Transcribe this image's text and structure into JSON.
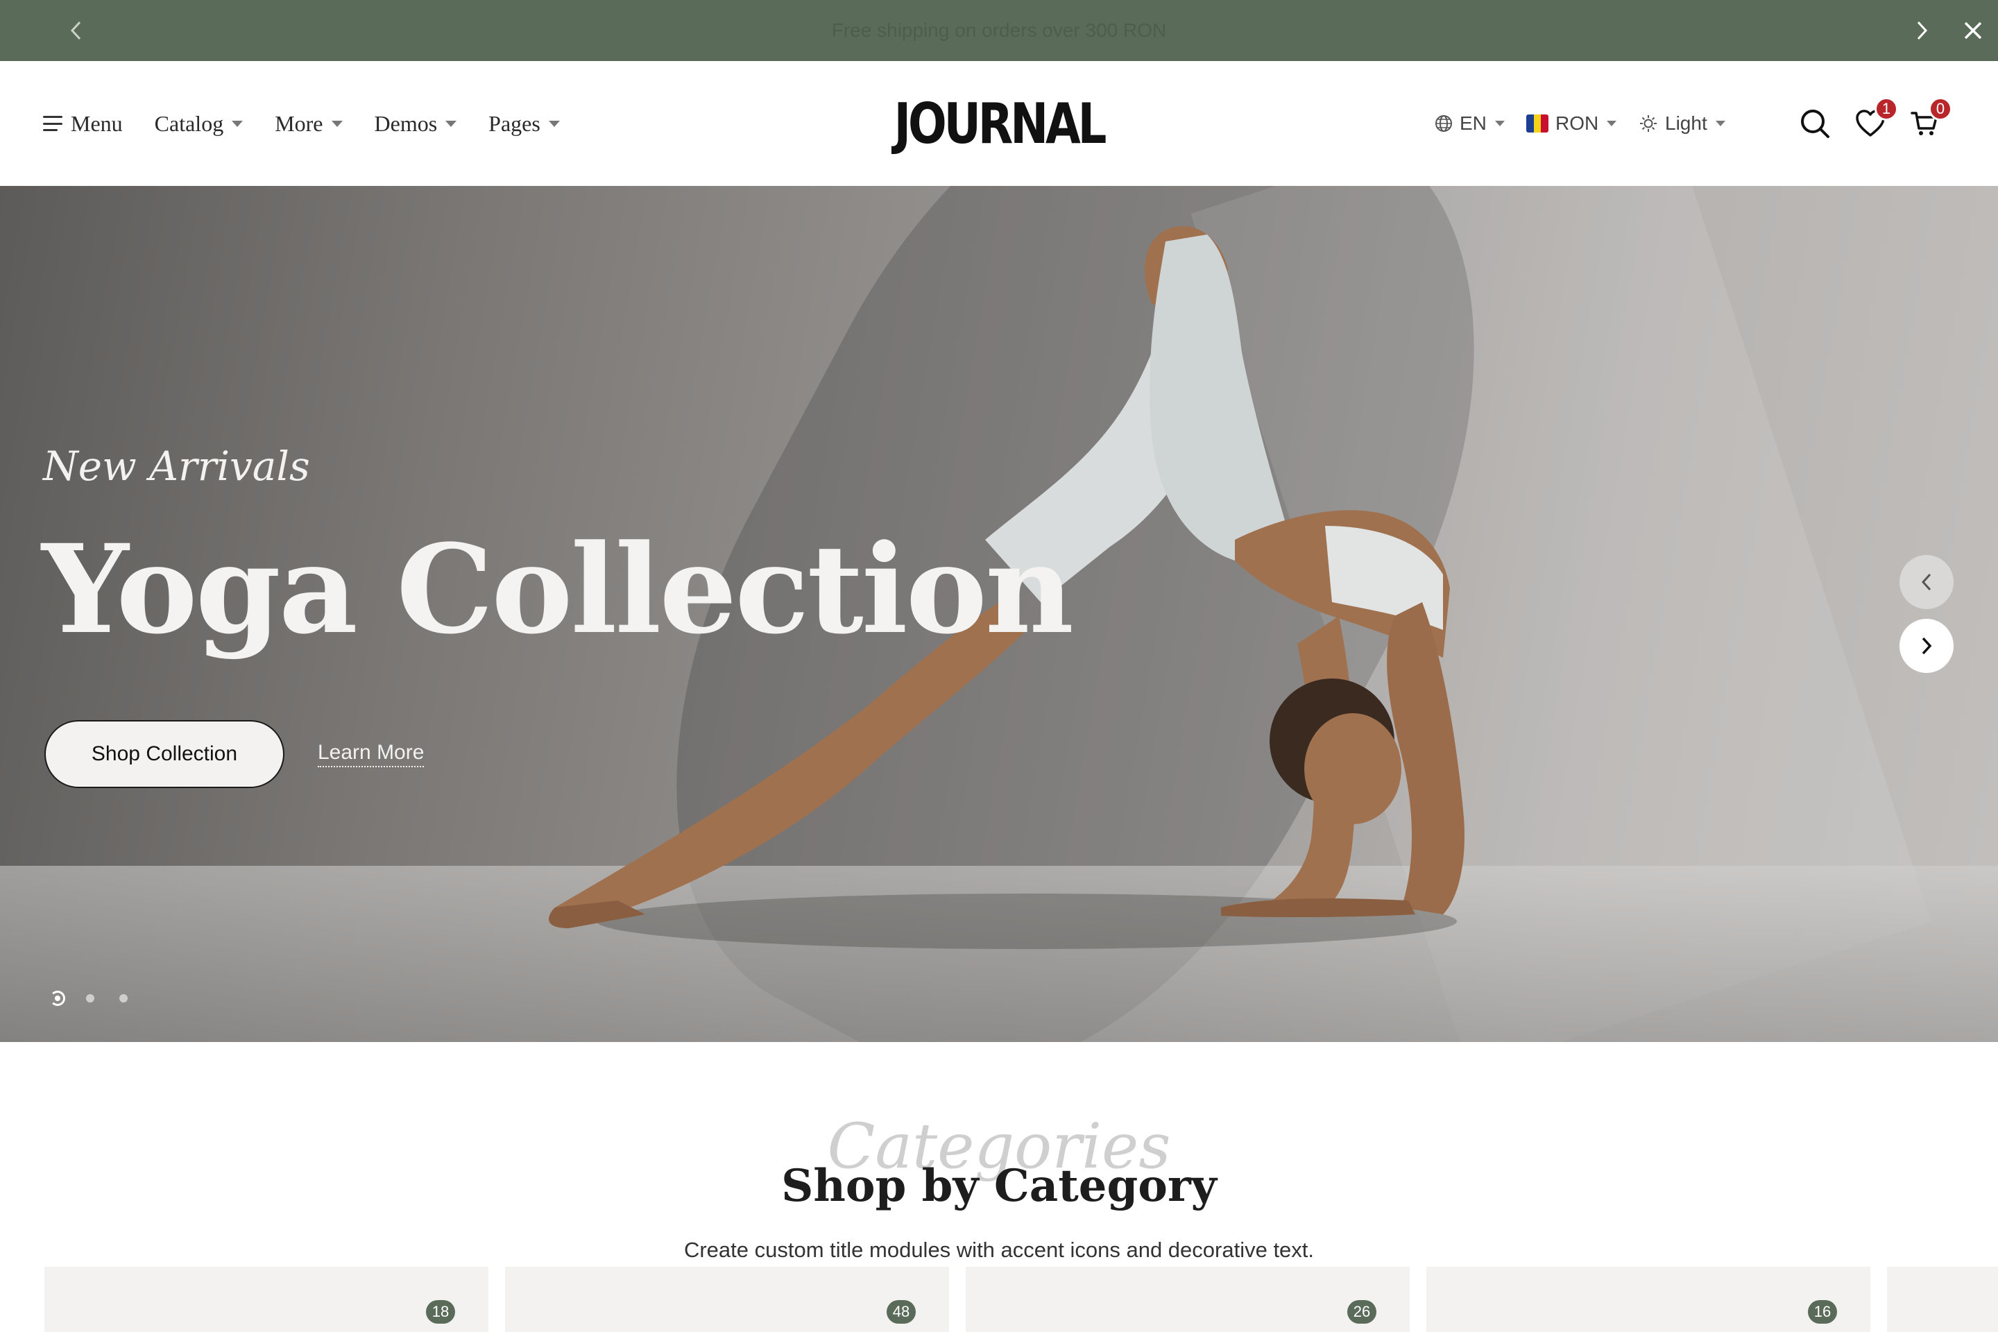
{
  "announcement": {
    "text": "Free shipping on orders over 300 RON",
    "prev_icon": "chevron-left-icon",
    "next_icon": "chevron-right-icon",
    "close_icon": "close-icon"
  },
  "header": {
    "logo": "JOURNAL",
    "nav": [
      {
        "label": "Menu",
        "icon": "hamburger-icon"
      },
      {
        "label": "Catalog",
        "dropdown": true
      },
      {
        "label": "More",
        "dropdown": true
      },
      {
        "label": "Demos",
        "dropdown": true
      },
      {
        "label": "Pages",
        "dropdown": true
      }
    ],
    "language": {
      "label": "EN",
      "icon": "globe-icon"
    },
    "currency": {
      "label": "RON",
      "icon": "romania-flag-icon"
    },
    "theme": {
      "label": "Light",
      "icon": "sun-icon"
    },
    "wishlist_count": "1",
    "cart_count": "0"
  },
  "hero": {
    "eyebrow": "New Arrivals",
    "title": "Yoga Collection",
    "primary_button": "Shop Collection",
    "secondary_link": "Learn More",
    "slide_count": 3,
    "active_slide": 1
  },
  "categories": {
    "decorative": "Categories",
    "title": "Shop by Category",
    "subtitle": "Create custom title modules with accent icons and decorative text.",
    "cards": [
      {
        "count": "18"
      },
      {
        "count": "48"
      },
      {
        "count": "26"
      },
      {
        "count": "16"
      }
    ]
  },
  "colors": {
    "topbar": "#5a6b5a",
    "badge": "#b8262c",
    "count_badge": "#5a6b5a"
  }
}
